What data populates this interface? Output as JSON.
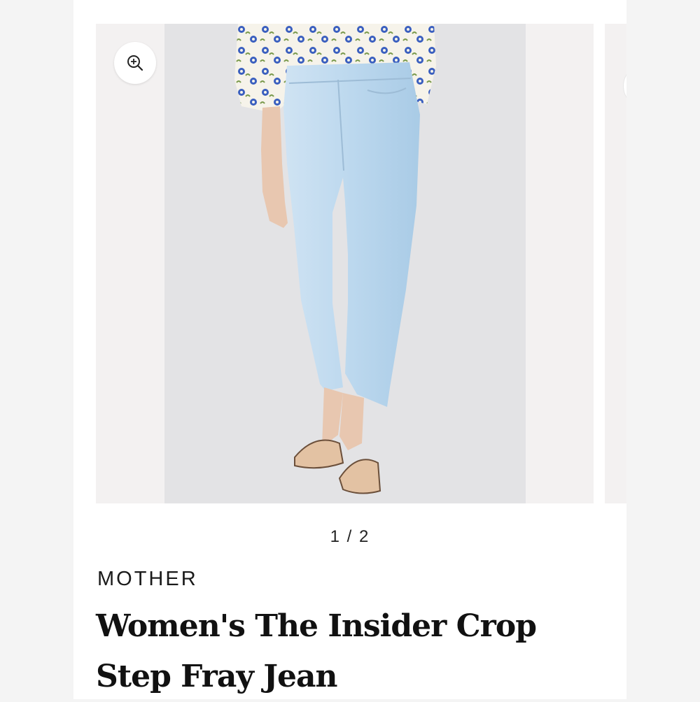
{
  "gallery": {
    "counter": "1 / 2",
    "zoom_icon": "zoom-in-icon"
  },
  "product": {
    "brand": "MOTHER",
    "title": "Women's The Insider Crop Step Fray Jean"
  },
  "colors": {
    "denim": "#bcd8ee",
    "top_pattern": "#3a5fbf",
    "sandal": "#e3c2a3"
  }
}
